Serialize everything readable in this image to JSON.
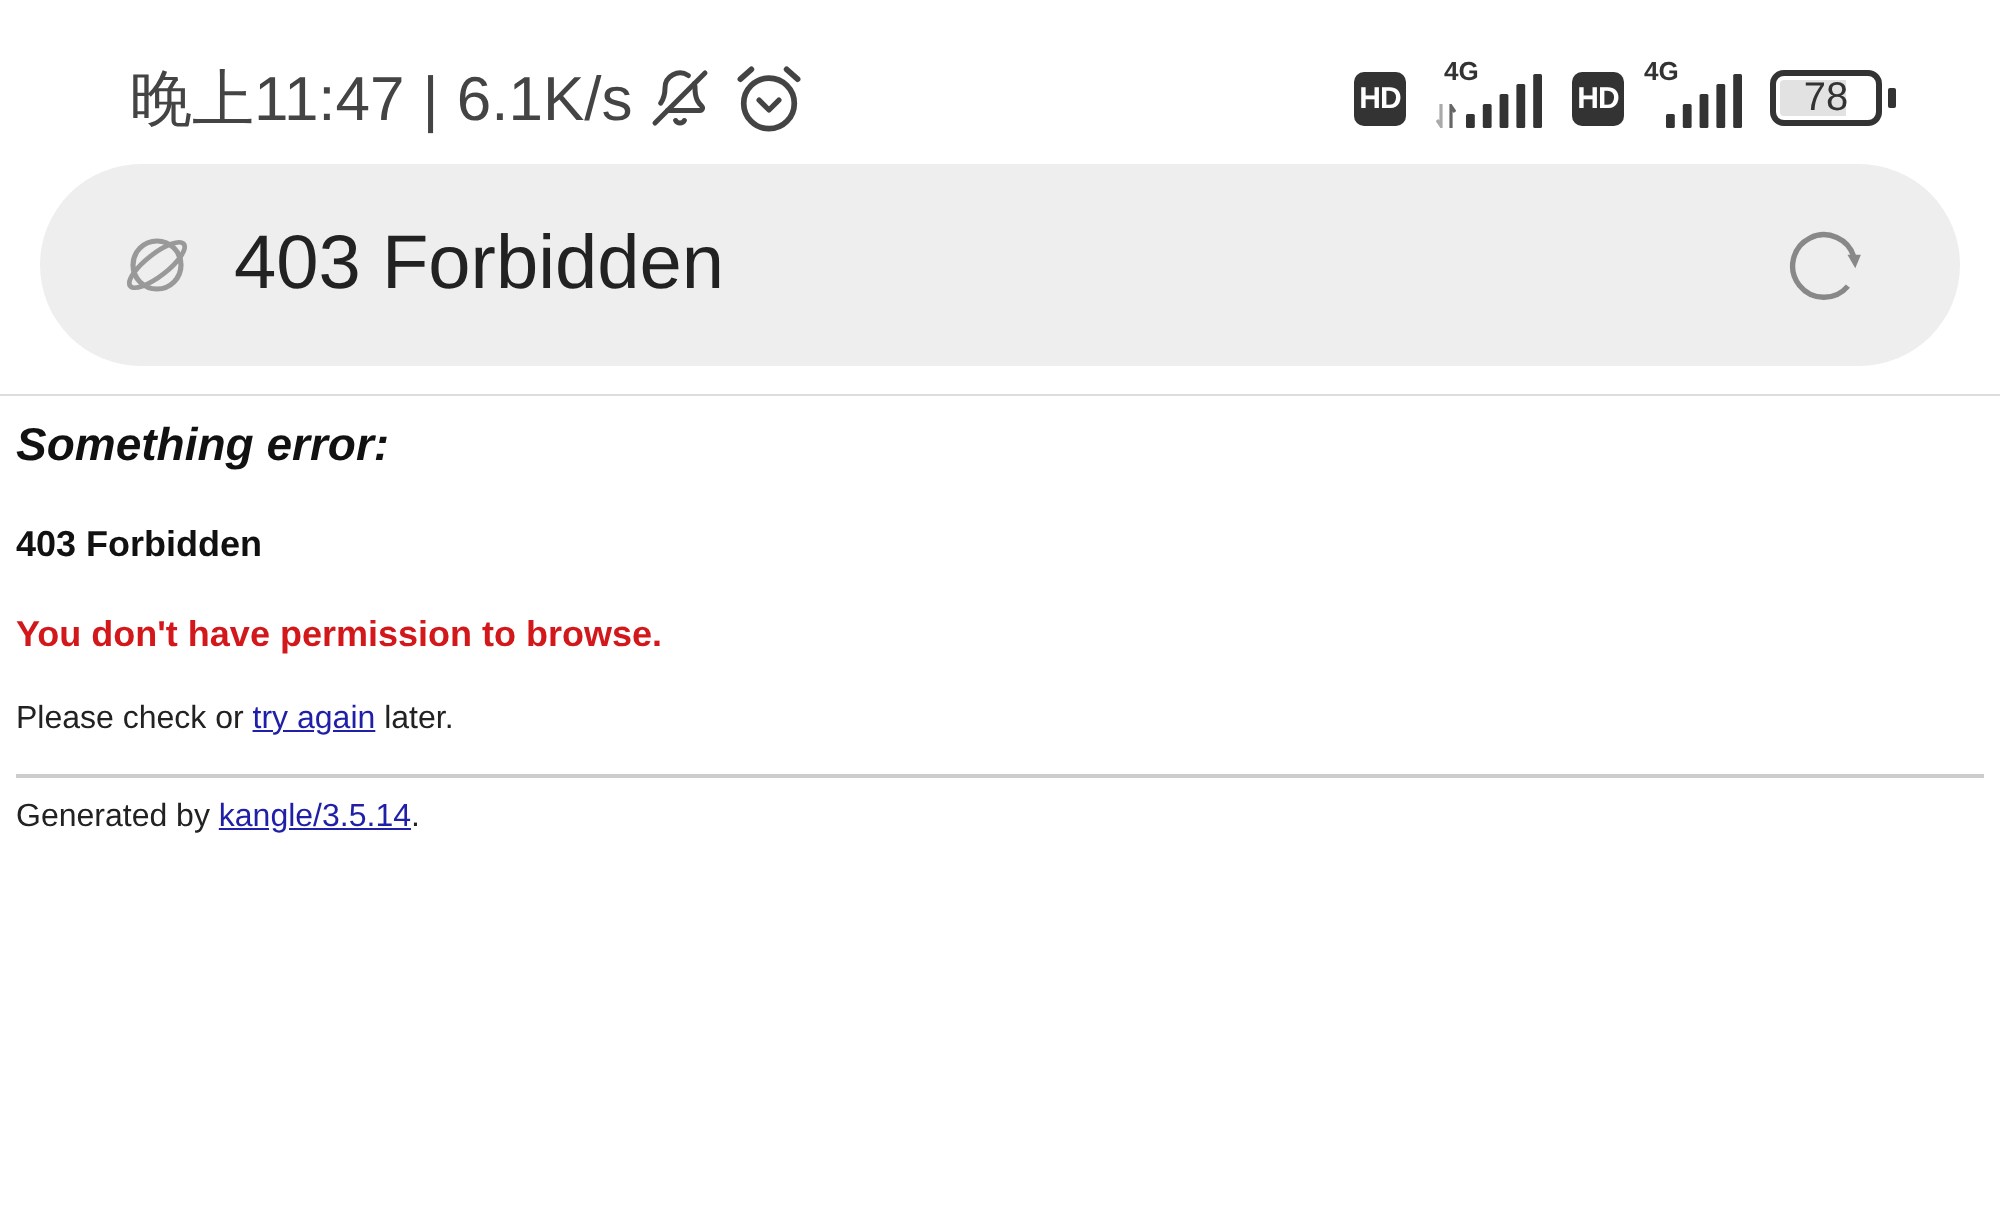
{
  "status_bar": {
    "time": "晚上11:47",
    "separator": "|",
    "net_speed": "6.1K/s",
    "sims": [
      {
        "badge": "HD",
        "network": "4G",
        "data_active": true
      },
      {
        "badge": "HD",
        "network": "4G",
        "data_active": false
      }
    ],
    "battery": "78"
  },
  "address_bar": {
    "title": "403 Forbidden"
  },
  "page": {
    "heading": "Something error:",
    "status": "403 Forbidden",
    "error": "You don't have permission to browse.",
    "message": {
      "before": "Please check or ",
      "link": "try again",
      "after": " later."
    },
    "footer": {
      "before": "Generated by ",
      "link": "kangle/3.5.14",
      "after": "."
    }
  }
}
